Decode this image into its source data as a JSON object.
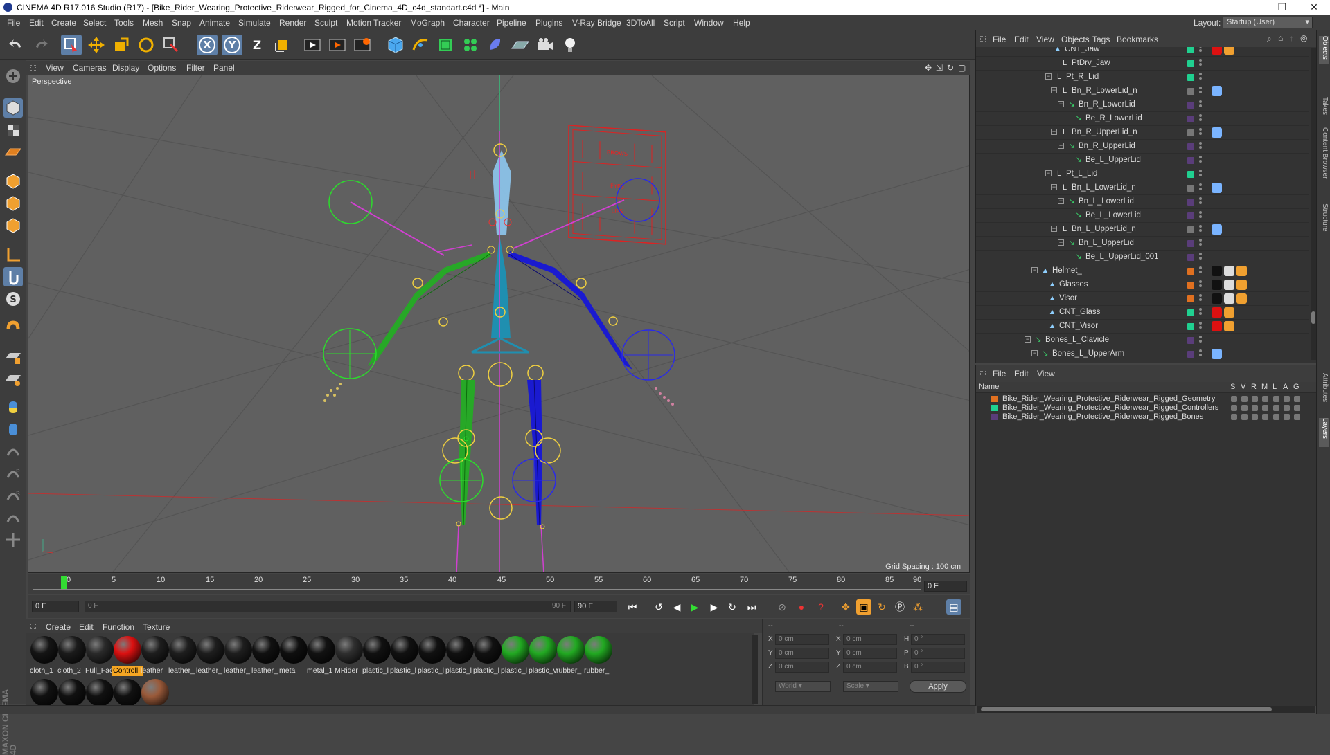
{
  "titlebar": {
    "title": "CINEMA 4D R17.016 Studio (R17) - [Bike_Rider_Wearing_Protective_Riderwear_Rigged_for_Cinema_4D_c4d_standart.c4d *] - Main",
    "minimize": "–",
    "maximize": "❐",
    "close": "✕"
  },
  "menubar": {
    "items": [
      "File",
      "Edit",
      "Create",
      "Select",
      "Tools",
      "Mesh",
      "Snap",
      "Animate",
      "Simulate",
      "Render",
      "Sculpt",
      "Motion Tracker",
      "MoGraph",
      "Character",
      "Pipeline",
      "Plugins",
      "V-Ray Bridge",
      "3DToAll",
      "Script",
      "Window",
      "Help"
    ],
    "layout_label": "Layout:",
    "layout_value": "Startup (User)"
  },
  "toolbar": {
    "axis_x": "X",
    "axis_y": "Y",
    "axis_z": "Z"
  },
  "viewport": {
    "menu": [
      "View",
      "Cameras",
      "Display",
      "Options",
      "Filter",
      "Panel"
    ],
    "label": "Perspective",
    "grid_spacing": "Grid Spacing : 100 cm",
    "controller_panel": {
      "brows": "BROWS",
      "eyes": "EYES",
      "lips": "LIPS"
    }
  },
  "timeline": {
    "ticks": [
      "0",
      "5",
      "10",
      "15",
      "20",
      "25",
      "30",
      "35",
      "40",
      "45",
      "50",
      "55",
      "60",
      "65",
      "70",
      "75",
      "80",
      "85",
      "90"
    ],
    "end_frame": "0 F"
  },
  "transport": {
    "start_field": "0 F",
    "range_start": "0 F",
    "range_end": "90 F",
    "end_field": "90 F"
  },
  "material_manager": {
    "menu": [
      "Create",
      "Edit",
      "Function",
      "Texture"
    ],
    "materials": [
      {
        "name": "cloth_1",
        "color": "#151515"
      },
      {
        "name": "cloth_2",
        "color": "#1b1b1b"
      },
      {
        "name": "Full_Fac",
        "color": "#2a2a2a"
      },
      {
        "name": "Controll",
        "color": "#dd1111",
        "selected": true
      },
      {
        "name": "leather",
        "color": "#1e1e1e"
      },
      {
        "name": "leather_",
        "color": "#1e1e1e"
      },
      {
        "name": "leather_",
        "color": "#1e1e1e"
      },
      {
        "name": "leather_",
        "color": "#1e1e1e"
      },
      {
        "name": "leather_",
        "color": "#111111"
      },
      {
        "name": "metal",
        "color": "#0f0f0f"
      },
      {
        "name": "metal_1",
        "color": "#121212"
      },
      {
        "name": "MRider",
        "color": "#2f2f2f"
      },
      {
        "name": "plastic_l",
        "color": "#111111"
      },
      {
        "name": "plastic_l",
        "color": "#111111"
      },
      {
        "name": "plastic_l",
        "color": "#111111"
      },
      {
        "name": "plastic_l",
        "color": "#111111"
      },
      {
        "name": "plastic_l",
        "color": "#111111"
      },
      {
        "name": "plastic_l",
        "color": "#22aa22"
      },
      {
        "name": "plastic_v",
        "color": "#22aa22"
      },
      {
        "name": "rubber_",
        "color": "#22aa22"
      },
      {
        "name": "rubber_",
        "color": "#22aa22"
      }
    ],
    "second_row": [
      {
        "color": "#111111"
      },
      {
        "color": "#111111"
      },
      {
        "color": "#111111"
      },
      {
        "color": "#111111"
      },
      {
        "color": "#9a5a3a"
      }
    ]
  },
  "coordinates": {
    "col1": [
      {
        "label": "X",
        "value": "0 cm"
      },
      {
        "label": "Y",
        "value": "0 cm"
      },
      {
        "label": "Z",
        "value": "0 cm"
      }
    ],
    "col2": [
      {
        "label": "X",
        "value": "0 cm"
      },
      {
        "label": "Y",
        "value": "0 cm"
      },
      {
        "label": "Z",
        "value": "0 cm"
      }
    ],
    "col3": [
      {
        "label": "H",
        "value": "0 °"
      },
      {
        "label": "P",
        "value": "0 °"
      },
      {
        "label": "B",
        "value": "0 °"
      }
    ],
    "col1_header": "--",
    "col2_header": "--",
    "col3_header": "--",
    "world": "World",
    "scale": "Scale",
    "apply": "Apply"
  },
  "object_manager": {
    "menu": [
      "File",
      "Edit",
      "View",
      "Objects",
      "Tags",
      "Bookmarks"
    ],
    "rows": [
      {
        "name": "CNT_Jaw",
        "indent": 110,
        "icon": "▲",
        "layer": "#20d090"
      },
      {
        "name": "PtDrv_Jaw",
        "indent": 120,
        "icon": "L0",
        "layer": "#20d090"
      },
      {
        "name": "Pt_R_Lid",
        "indent": 112,
        "icon": "L0",
        "layer": "#20d090",
        "exp": "−"
      },
      {
        "name": "Bn_R_LowerLid_n",
        "indent": 120,
        "icon": "L0",
        "layer": "#777777",
        "exp": "−"
      },
      {
        "name": "Bn_R_LowerLid",
        "indent": 130,
        "icon": "↘",
        "layer": "#5a3d7a",
        "exp": "−"
      },
      {
        "name": "Be_R_LowerLid",
        "indent": 140,
        "icon": "↘",
        "layer": "#5a3d7a"
      },
      {
        "name": "Bn_R_UpperLid_n",
        "indent": 120,
        "icon": "L0",
        "layer": "#777777",
        "exp": "−"
      },
      {
        "name": "Bn_R_UpperLid",
        "indent": 130,
        "icon": "↘",
        "layer": "#5a3d7a",
        "exp": "−"
      },
      {
        "name": "Be_L_UpperLid",
        "indent": 140,
        "icon": "↘",
        "layer": "#5a3d7a"
      },
      {
        "name": "Pt_L_Lid",
        "indent": 112,
        "icon": "L0",
        "layer": "#20d090",
        "exp": "−"
      },
      {
        "name": "Bn_L_LowerLid_n",
        "indent": 120,
        "icon": "L0",
        "layer": "#777777",
        "exp": "−"
      },
      {
        "name": "Bn_L_LowerLid",
        "indent": 130,
        "icon": "↘",
        "layer": "#5a3d7a",
        "exp": "−"
      },
      {
        "name": "Be_L_LowerLid",
        "indent": 140,
        "icon": "↘",
        "layer": "#5a3d7a"
      },
      {
        "name": "Bn_L_UpperLid_n",
        "indent": 120,
        "icon": "L0",
        "layer": "#777777",
        "exp": "−"
      },
      {
        "name": "Bn_L_UpperLid",
        "indent": 130,
        "icon": "↘",
        "layer": "#5a3d7a",
        "exp": "−"
      },
      {
        "name": "Be_L_UpperLid_001",
        "indent": 140,
        "icon": "↘",
        "layer": "#5a3d7a"
      },
      {
        "name": "Helmet_",
        "indent": 92,
        "icon": "▲",
        "layer": "#e07020",
        "exp": "−"
      },
      {
        "name": "Glasses",
        "indent": 102,
        "icon": "▲",
        "layer": "#e07020"
      },
      {
        "name": "Visor",
        "indent": 102,
        "icon": "▲",
        "layer": "#e07020"
      },
      {
        "name": "CNT_Glass",
        "indent": 102,
        "icon": "▲",
        "layer": "#20d090"
      },
      {
        "name": "CNT_Visor",
        "indent": 102,
        "icon": "▲",
        "layer": "#20d090"
      },
      {
        "name": "Bones_L_Clavicle",
        "indent": 82,
        "icon": "↘",
        "layer": "#5a3d7a",
        "exp": "−"
      },
      {
        "name": "Bones_L_UpperArm",
        "indent": 92,
        "icon": "↘",
        "layer": "#5a3d7a",
        "exp": "−"
      }
    ]
  },
  "layer_manager": {
    "menu": [
      "File",
      "Edit",
      "View"
    ],
    "header": {
      "name": "Name",
      "s": "S",
      "v": "V",
      "r": "R",
      "m": "M",
      "l": "L",
      "a": "A",
      "g": "G"
    },
    "layers": [
      {
        "name": "Bike_Rider_Wearing_Protective_Riderwear_Rigged_Geometry",
        "color": "#e07020"
      },
      {
        "name": "Bike_Rider_Wearing_Protective_Riderwear_Rigged_Controllers",
        "color": "#20d090"
      },
      {
        "name": "Bike_Rider_Wearing_Protective_Riderwear_Rigged_Bones",
        "color": "#5a3d7a"
      }
    ]
  },
  "side_tabs": [
    "Objects",
    "Takes",
    "Content Browser",
    "Structure",
    "Attributes",
    "Layers"
  ],
  "branding": "MAXON CINEMA 4D"
}
